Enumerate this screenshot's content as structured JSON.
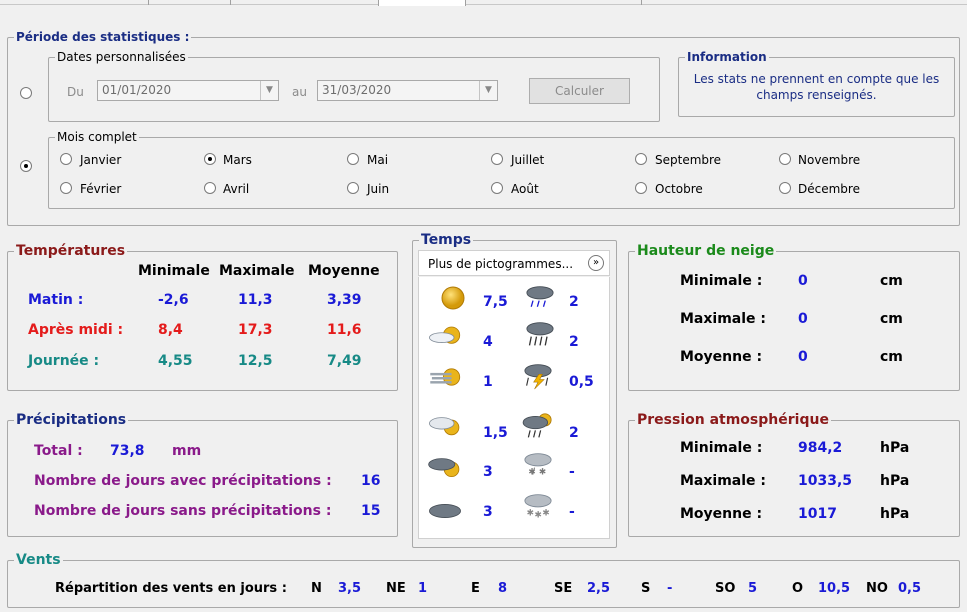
{
  "periode": {
    "title": "Période des statistiques :",
    "dates": {
      "title": "Dates personnalisées",
      "du_label": "Du",
      "du_value": "01/01/2020",
      "au_label": "au",
      "au_value": "31/03/2020",
      "calculate_label": "Calculer",
      "selected": false
    },
    "information": {
      "title": "Information",
      "text": "Les stats ne prennent en compte que les champs renseignés."
    },
    "mois": {
      "title": "Mois complet",
      "selected": true,
      "months": [
        "Janvier",
        "Février",
        "Mars",
        "Avril",
        "Mai",
        "Juin",
        "Juillet",
        "Août",
        "Septembre",
        "Octobre",
        "Novembre",
        "Décembre"
      ],
      "selected_month": "Mars"
    }
  },
  "temperatures": {
    "title": "Températures",
    "headers": [
      "Minimale",
      "Maximale",
      "Moyenne"
    ],
    "rows": [
      {
        "label": "Matin :",
        "values": [
          "-2,6",
          "11,3",
          "3,39"
        ],
        "color": "#1a1ad6"
      },
      {
        "label": "Après midi :",
        "values": [
          "8,4",
          "17,3",
          "11,6"
        ],
        "color": "#e41b1b"
      },
      {
        "label": "Journée :",
        "values": [
          "4,55",
          "12,5",
          "7,49"
        ],
        "color": "#178a86"
      }
    ]
  },
  "temps": {
    "title": "Temps",
    "pictos_label": "Plus de pictogrammes...",
    "left": [
      {
        "icon": "sun-icon",
        "value": "7,5"
      },
      {
        "icon": "sun-behind-cloud-icon",
        "value": "4"
      },
      {
        "icon": "sun-haze-icon",
        "value": "1"
      },
      {
        "icon": "partly-cloudy-icon",
        "value": "1,5"
      },
      {
        "icon": "cloudy-sun-icon",
        "value": "3"
      },
      {
        "icon": "overcast-icon",
        "value": "3"
      }
    ],
    "right": [
      {
        "icon": "rain-cloud-icon",
        "value": "2"
      },
      {
        "icon": "heavy-rain-icon",
        "value": "2"
      },
      {
        "icon": "thunderstorm-icon",
        "value": "0,5"
      },
      {
        "icon": "sun-rain-icon",
        "value": "2"
      },
      {
        "icon": "sleet-icon",
        "value": "-"
      },
      {
        "icon": "snow-icon",
        "value": "-"
      }
    ]
  },
  "neige": {
    "title": "Hauteur de neige",
    "rows": [
      {
        "label": "Minimale :",
        "value": "0",
        "unit": "cm"
      },
      {
        "label": "Maximale :",
        "value": "0",
        "unit": "cm"
      },
      {
        "label": "Moyenne :",
        "value": "0",
        "unit": "cm"
      }
    ]
  },
  "precipitations": {
    "title": "Précipitations",
    "total_label": "Total :",
    "total_value": "73,8",
    "total_unit": "mm",
    "avec_label": "Nombre de jours avec précipitations :",
    "avec_value": "16",
    "sans_label": "Nombre de jours sans précipitations :",
    "sans_value": "15"
  },
  "pression": {
    "title": "Pression atmosphérique",
    "rows": [
      {
        "label": "Minimale :",
        "value": "984,2",
        "unit": "hPa"
      },
      {
        "label": "Maximale :",
        "value": "1033,5",
        "unit": "hPa"
      },
      {
        "label": "Moyenne :",
        "value": "1017",
        "unit": "hPa"
      }
    ]
  },
  "vents": {
    "title": "Vents",
    "label": "Répartition des vents en jours :",
    "items": [
      {
        "dir": "N",
        "value": "3,5"
      },
      {
        "dir": "NE",
        "value": "1"
      },
      {
        "dir": "E",
        "value": "8"
      },
      {
        "dir": "SE",
        "value": "2,5"
      },
      {
        "dir": "S",
        "value": "-"
      },
      {
        "dir": "SO",
        "value": "5"
      },
      {
        "dir": "O",
        "value": "10,5"
      },
      {
        "dir": "NO",
        "value": "0,5"
      }
    ]
  }
}
